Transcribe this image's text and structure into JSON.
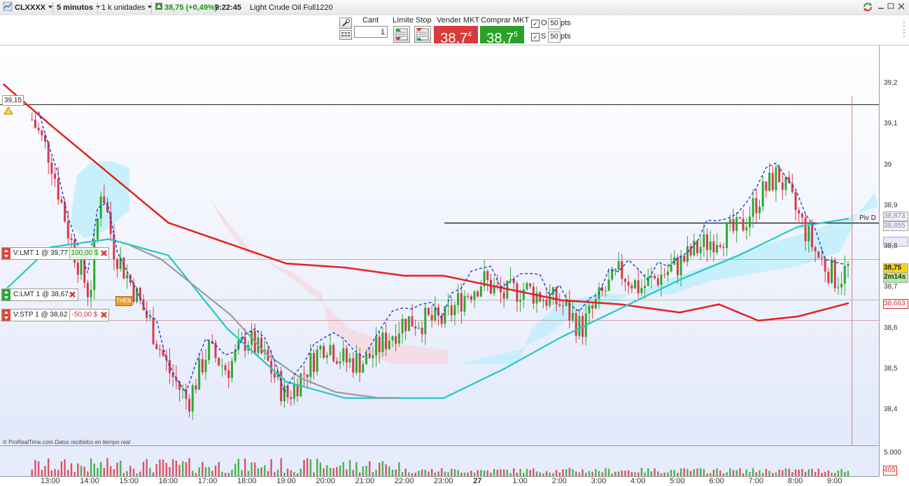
{
  "toolbar": {
    "symbol": "CLXXXX",
    "timeframe": "5 minutos",
    "units": "1 k unidades",
    "price_change": "38,75 (+0,49%)",
    "time": "9:22:45",
    "instrument": "Light Crude Oil Full1220"
  },
  "order_bar": {
    "qty_label": "Cant",
    "qty_value": "1",
    "limit_label": "Límite",
    "stop_label": "Stop",
    "sell_label": "Vender MKT",
    "buy_label": "Comprar MKT",
    "sell_price": "38,7",
    "sell_price_sup": "4",
    "buy_price": "38,7",
    "buy_price_sup": "5",
    "o_label": "O",
    "s_label": "S",
    "o_pts": "50",
    "s_pts": "50",
    "pts_label": "pts",
    "checked_mark": "✓"
  },
  "chart": {
    "watermark": "© ProRealTime.com",
    "watermark_note": "Datos recibidos en tiempo real",
    "high_level_label": "39,15",
    "piv_label": "Piv D",
    "then_label": "THEN",
    "orders": [
      {
        "type": "V:LMT 1 @ 39,77",
        "pnl": "100,00 $"
      },
      {
        "type": "C:LMT 1 @ 38,67",
        "pnl": ""
      },
      {
        "type": "V:STP 1 @ 38,62",
        "pnl": "-50,00 $"
      }
    ],
    "right_tags": {
      "last_price": "38,75",
      "countdown": "2m14s",
      "ma_price": "38,663",
      "piv1": "38,873",
      "piv2": "38,855",
      "volume_max": "5.000",
      "volume_last": "405"
    },
    "y_labels": [
      "39,2",
      "39,1",
      "39",
      "38,9",
      "38,8",
      "38,7",
      "38,6",
      "38,5",
      "38,4"
    ],
    "x_labels": [
      "13:00",
      "14:00",
      "15:00",
      "16:00",
      "17:00",
      "18:00",
      "19:00",
      "20:00",
      "21:00",
      "22:00",
      "23:00",
      "27",
      "1:00",
      "2:00",
      "3:00",
      "4:00",
      "5:00",
      "6:00",
      "7:00",
      "8:00",
      "9:00"
    ],
    "colors": {
      "up": "#2ea82e",
      "down": "#d63a4a",
      "ma_red": "#e82020",
      "ma_teal": "#22c8c8",
      "kijun": "#1a3fd6",
      "cloud": "#bfeefa"
    }
  },
  "chart_data": {
    "type": "candlestick",
    "y_axis_range": [
      38.32,
      39.28
    ],
    "y_ticks": [
      39.2,
      39.1,
      39.0,
      38.9,
      38.8,
      38.7,
      38.6,
      38.5,
      38.4
    ],
    "x_ticks": [
      "13:00",
      "14:00",
      "15:00",
      "16:00",
      "17:00",
      "18:00",
      "19:00",
      "20:00",
      "21:00",
      "22:00",
      "23:00",
      "27",
      "1:00",
      "2:00",
      "3:00",
      "4:00",
      "5:00",
      "6:00",
      "7:00",
      "8:00",
      "9:00"
    ],
    "close_path": [
      [
        12.5,
        39.12
      ],
      [
        13.0,
        39.02
      ],
      [
        13.5,
        38.82
      ],
      [
        14.0,
        38.68
      ],
      [
        14.3,
        38.96
      ],
      [
        14.6,
        38.8
      ],
      [
        15.0,
        38.72
      ],
      [
        15.5,
        38.62
      ],
      [
        16.0,
        38.5
      ],
      [
        16.5,
        38.42
      ],
      [
        17.0,
        38.55
      ],
      [
        17.5,
        38.5
      ],
      [
        18.0,
        38.58
      ],
      [
        18.5,
        38.52
      ],
      [
        19.0,
        38.43
      ],
      [
        19.5,
        38.5
      ],
      [
        20.0,
        38.57
      ],
      [
        20.5,
        38.52
      ],
      [
        21.0,
        38.52
      ],
      [
        21.5,
        38.57
      ],
      [
        22.0,
        38.62
      ],
      [
        23.0,
        38.62
      ],
      [
        23.5,
        38.68
      ],
      [
        24.0,
        38.72
      ],
      [
        24.5,
        38.68
      ],
      [
        25.0,
        38.7
      ],
      [
        25.5,
        38.68
      ],
      [
        26.0,
        38.66
      ],
      [
        26.5,
        38.6
      ],
      [
        27.0,
        38.68
      ],
      [
        27.5,
        38.74
      ],
      [
        28.0,
        38.7
      ],
      [
        28.5,
        38.73
      ],
      [
        29.0,
        38.76
      ],
      [
        29.5,
        38.8
      ],
      [
        30.0,
        38.83
      ],
      [
        30.5,
        38.84
      ],
      [
        31.0,
        38.92
      ],
      [
        31.5,
        38.98
      ],
      [
        32.0,
        38.88
      ],
      [
        32.5,
        38.78
      ],
      [
        33.0,
        38.72
      ],
      [
        33.3,
        38.75
      ]
    ],
    "series": [
      {
        "name": "ma_red",
        "points": [
          [
            11.8,
            39.2
          ],
          [
            13.0,
            39.1
          ],
          [
            14.5,
            38.98
          ],
          [
            16.0,
            38.86
          ],
          [
            17.5,
            38.81
          ],
          [
            19.0,
            38.76
          ],
          [
            20.5,
            38.75
          ],
          [
            22.0,
            38.73
          ],
          [
            23.0,
            38.73
          ],
          [
            24.5,
            38.7
          ],
          [
            26.0,
            38.67
          ],
          [
            27.5,
            38.66
          ],
          [
            29.0,
            38.64
          ],
          [
            30.0,
            38.66
          ],
          [
            31.0,
            38.62
          ],
          [
            32.0,
            38.63
          ],
          [
            33.3,
            38.663
          ]
        ]
      },
      {
        "name": "ma_teal",
        "points": [
          [
            11.9,
            38.7
          ],
          [
            13.0,
            38.8
          ],
          [
            14.5,
            38.82
          ],
          [
            16.0,
            38.78
          ],
          [
            17.5,
            38.6
          ],
          [
            19.0,
            38.47
          ],
          [
            20.5,
            38.43
          ],
          [
            22.0,
            38.43
          ],
          [
            23.0,
            38.43
          ],
          [
            24.5,
            38.5
          ],
          [
            26.0,
            38.58
          ],
          [
            27.5,
            38.65
          ],
          [
            29.0,
            38.72
          ],
          [
            30.5,
            38.78
          ],
          [
            32.0,
            38.85
          ],
          [
            33.3,
            38.87
          ]
        ]
      }
    ]
  }
}
